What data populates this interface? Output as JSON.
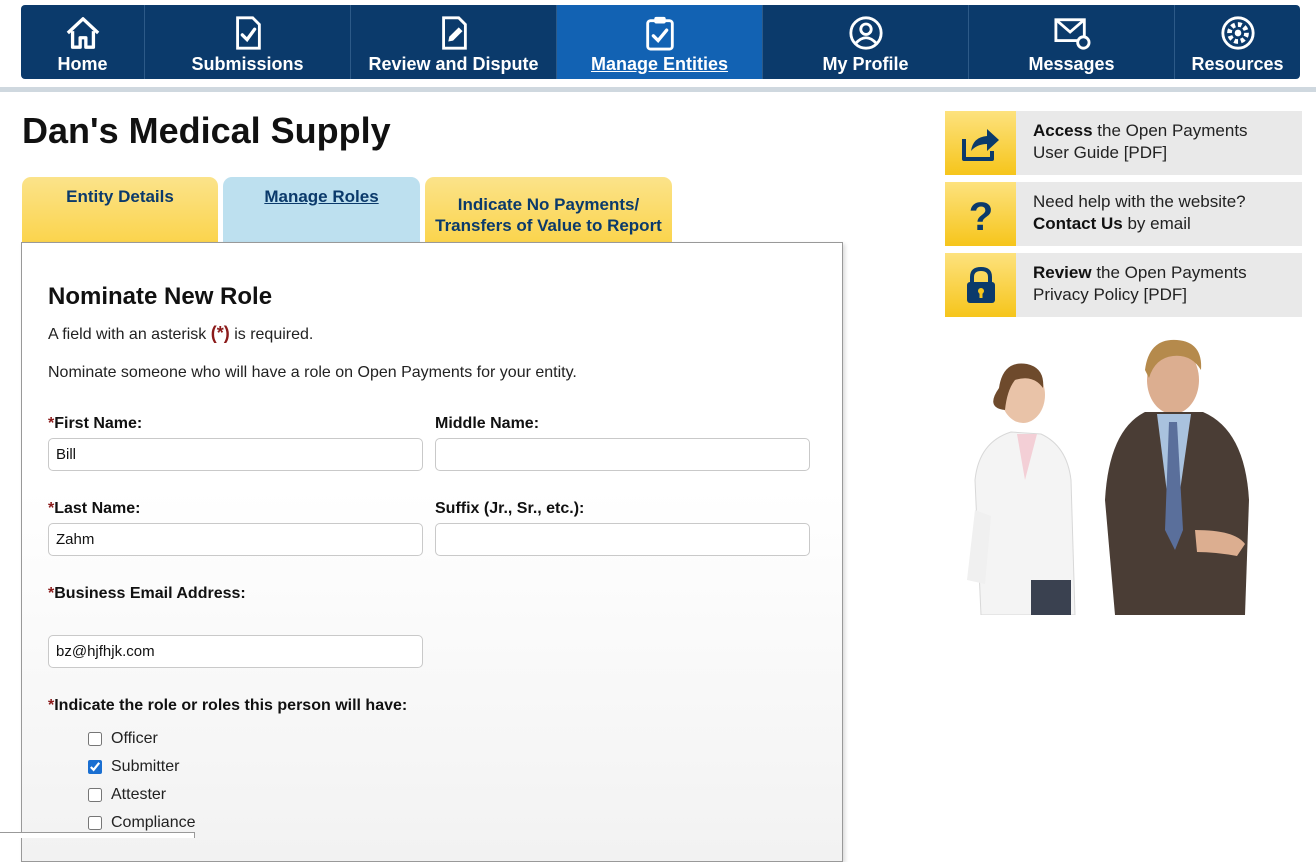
{
  "nav": {
    "items": [
      {
        "label": "Home",
        "icon": "home-icon"
      },
      {
        "label": "Submissions",
        "icon": "document-check-icon"
      },
      {
        "label": "Review and Dispute",
        "icon": "document-edit-icon"
      },
      {
        "label": "Manage Entities",
        "icon": "clipboard-check-icon"
      },
      {
        "label": "My Profile",
        "icon": "user-circle-icon"
      },
      {
        "label": "Messages",
        "icon": "envelope-icon"
      },
      {
        "label": "Resources",
        "icon": "gear-icon"
      }
    ],
    "active_index": 3
  },
  "entity_title": "Dan's Medical Supply",
  "tabs": {
    "entity_details": "Entity Details",
    "manage_roles": "Manage Roles",
    "no_payments_line1": "Indicate No Payments/",
    "no_payments_line2": "Transfers of Value to Report"
  },
  "form": {
    "title": "Nominate New Role",
    "required_note_before": "A field with an asterisk ",
    "required_note_mark": "(*)",
    "required_note_after": " is required.",
    "intro": "Nominate someone who will have a role on Open Payments for your entity.",
    "asterisk": "*",
    "first_name_label": "First Name:",
    "first_name_value": "Bill",
    "middle_name_label": "Middle Name:",
    "middle_name_value": "",
    "last_name_label": "Last Name:",
    "last_name_value": "Zahm",
    "suffix_label": "Suffix (Jr., Sr., etc.):",
    "suffix_value": "",
    "email_label": "Business Email Address:",
    "email_value": "bz@hjfhjk.com",
    "roles_label": "Indicate the role or roles this person will have:",
    "roles": [
      {
        "label": "Officer",
        "checked": false
      },
      {
        "label": "Submitter",
        "checked": true
      },
      {
        "label": "Attester",
        "checked": false
      },
      {
        "label": "Compliance",
        "checked": false
      }
    ]
  },
  "sidebar": {
    "guide": {
      "bold": "Access",
      "rest1": " the Open Payments",
      "line2": "User Guide [PDF]",
      "icon": "share-arrow-icon"
    },
    "help": {
      "line1": "Need help with the website?",
      "bold": "Contact Us",
      "rest2": " by email",
      "icon": "question-icon"
    },
    "privacy": {
      "bold": "Review",
      "rest1": " the Open Payments",
      "line2": "Privacy Policy [PDF]",
      "icon": "lock-icon"
    }
  },
  "colors": {
    "nav_bg": "#0b3a6b",
    "nav_active": "#1262b3",
    "tab_yellow": "#fbd44c",
    "tab_blue": "#bde0ef",
    "required_red": "#8b1a1a"
  }
}
